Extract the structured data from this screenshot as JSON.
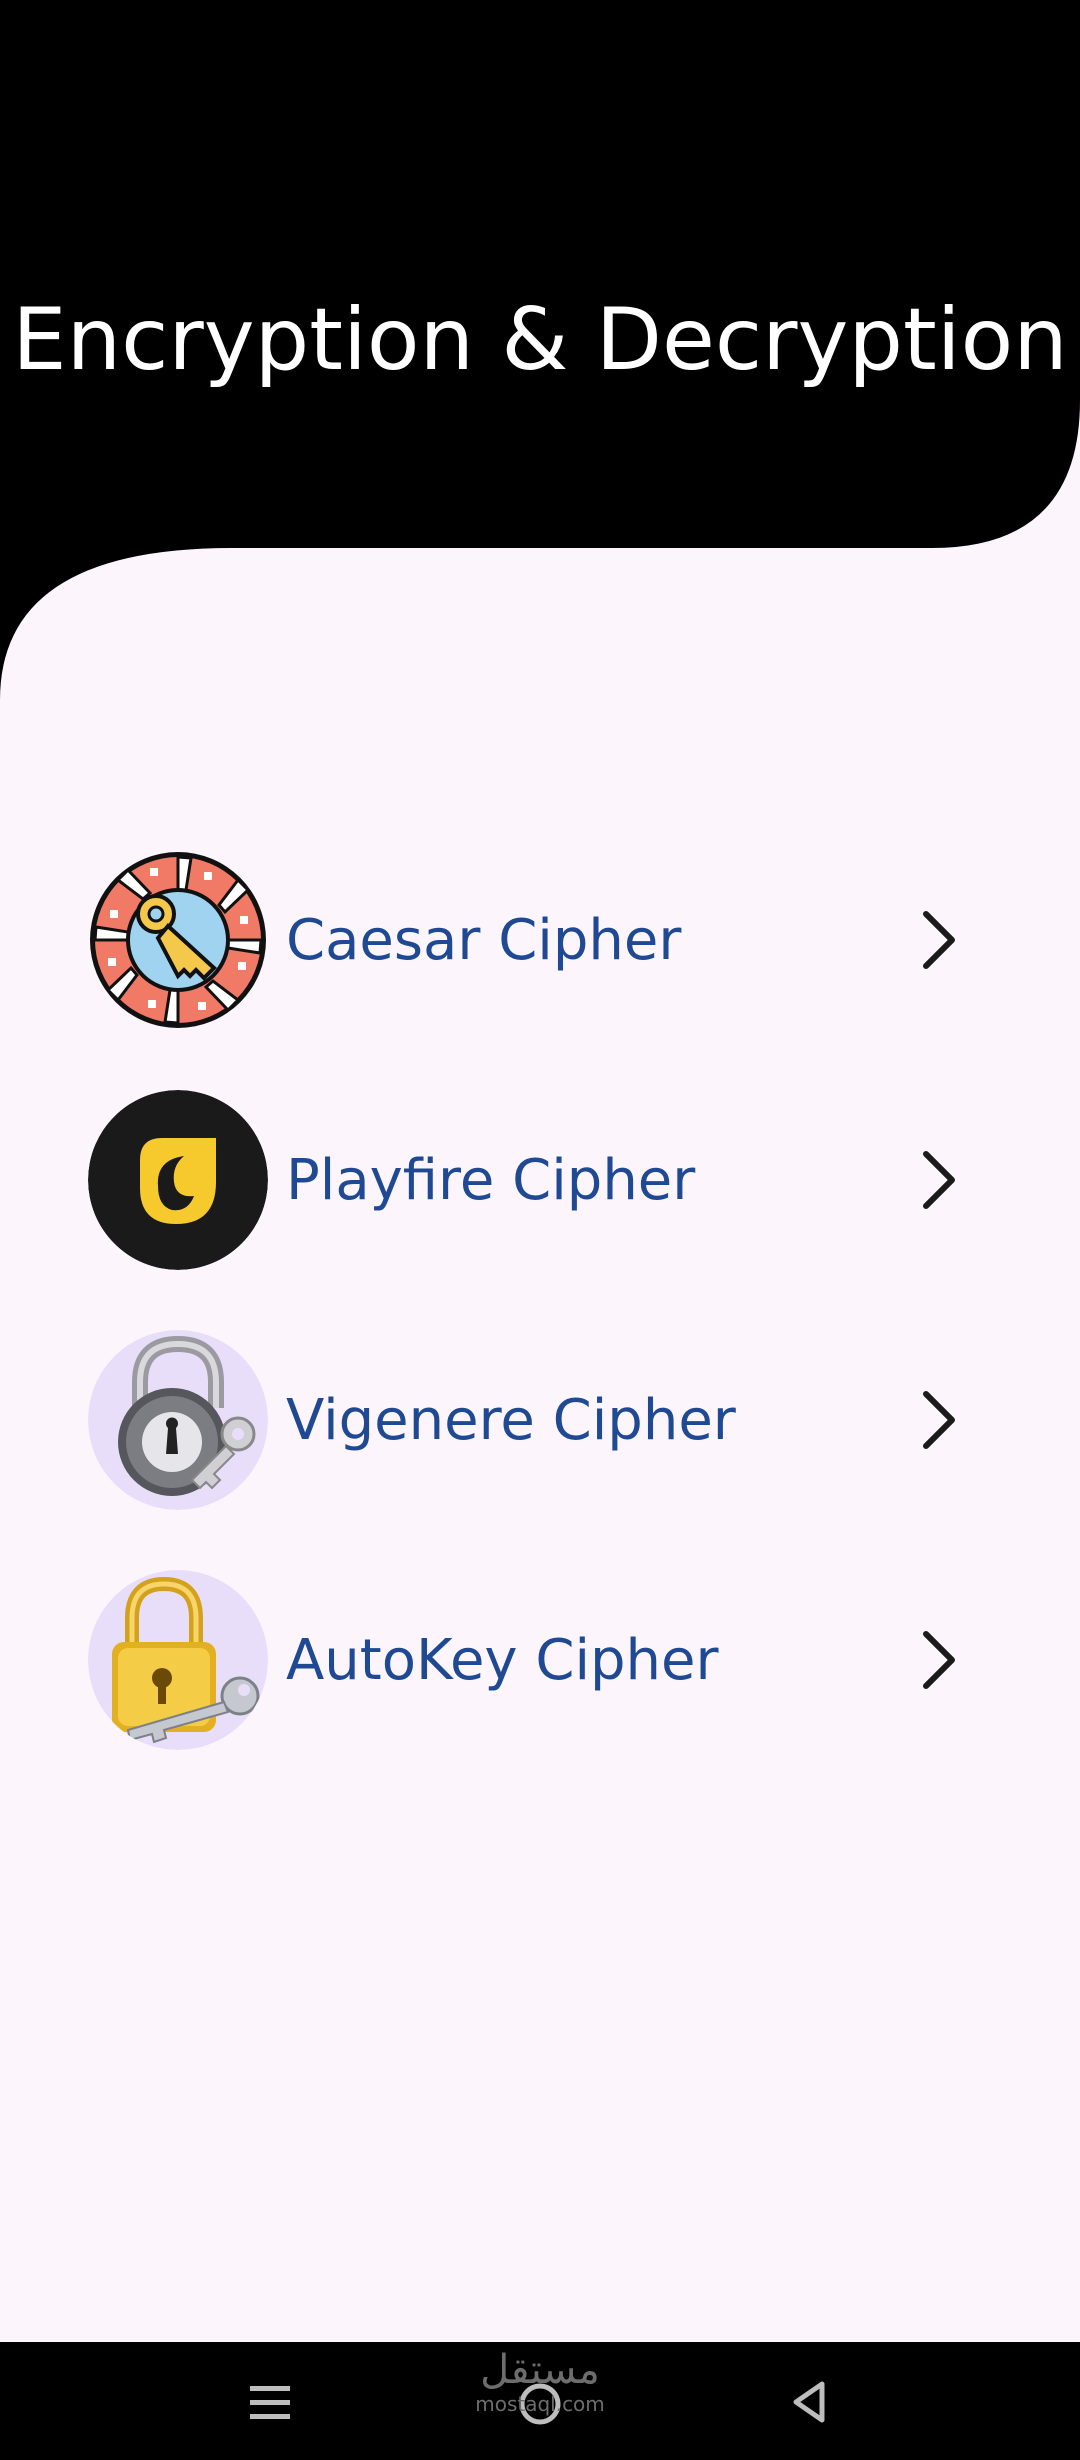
{
  "header": {
    "title": "Encryption & Decryption"
  },
  "ciphers": [
    {
      "label": "Caesar Cipher",
      "icon": "wheel-key-icon"
    },
    {
      "label": "Playfire Cipher",
      "icon": "flame-logo-icon"
    },
    {
      "label": "Vigenere Cipher",
      "icon": "combination-lock-key-icon"
    },
    {
      "label": "AutoKey Cipher",
      "icon": "gold-padlock-key-icon"
    }
  ],
  "navbar": {
    "buttons": [
      "menu-icon",
      "home-icon",
      "back-icon"
    ],
    "watermark": "مستقل",
    "watermark_sub": "mostaql.com"
  },
  "colors": {
    "header": "#000000",
    "background": "#fcf5fc",
    "label": "#1f4a93",
    "icon_bg": "#e8defa"
  }
}
